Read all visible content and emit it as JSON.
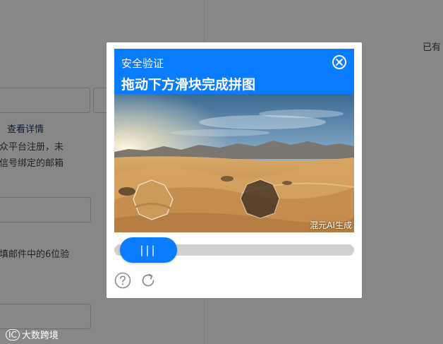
{
  "background": {
    "top_right_text": "已有",
    "details_link": "查看详情",
    "desc_line1": "众平台注册，未",
    "desc_line2": "信号绑定的邮箱",
    "code_hint": "填邮件中的6位验",
    "footer_text": "大数跨境",
    "footer_logo": "IC"
  },
  "captcha": {
    "subtitle": "安全验证",
    "title": "拖动下方滑块完成拼图",
    "watermark": "混元AI生成",
    "slider_grip": "|||",
    "slider_progress": 0,
    "icons": {
      "close": "close-circle-icon",
      "help": "help-circle-icon",
      "refresh": "refresh-icon"
    },
    "colors": {
      "accent": "#0a7cff",
      "track": "#d0d0d0"
    }
  }
}
